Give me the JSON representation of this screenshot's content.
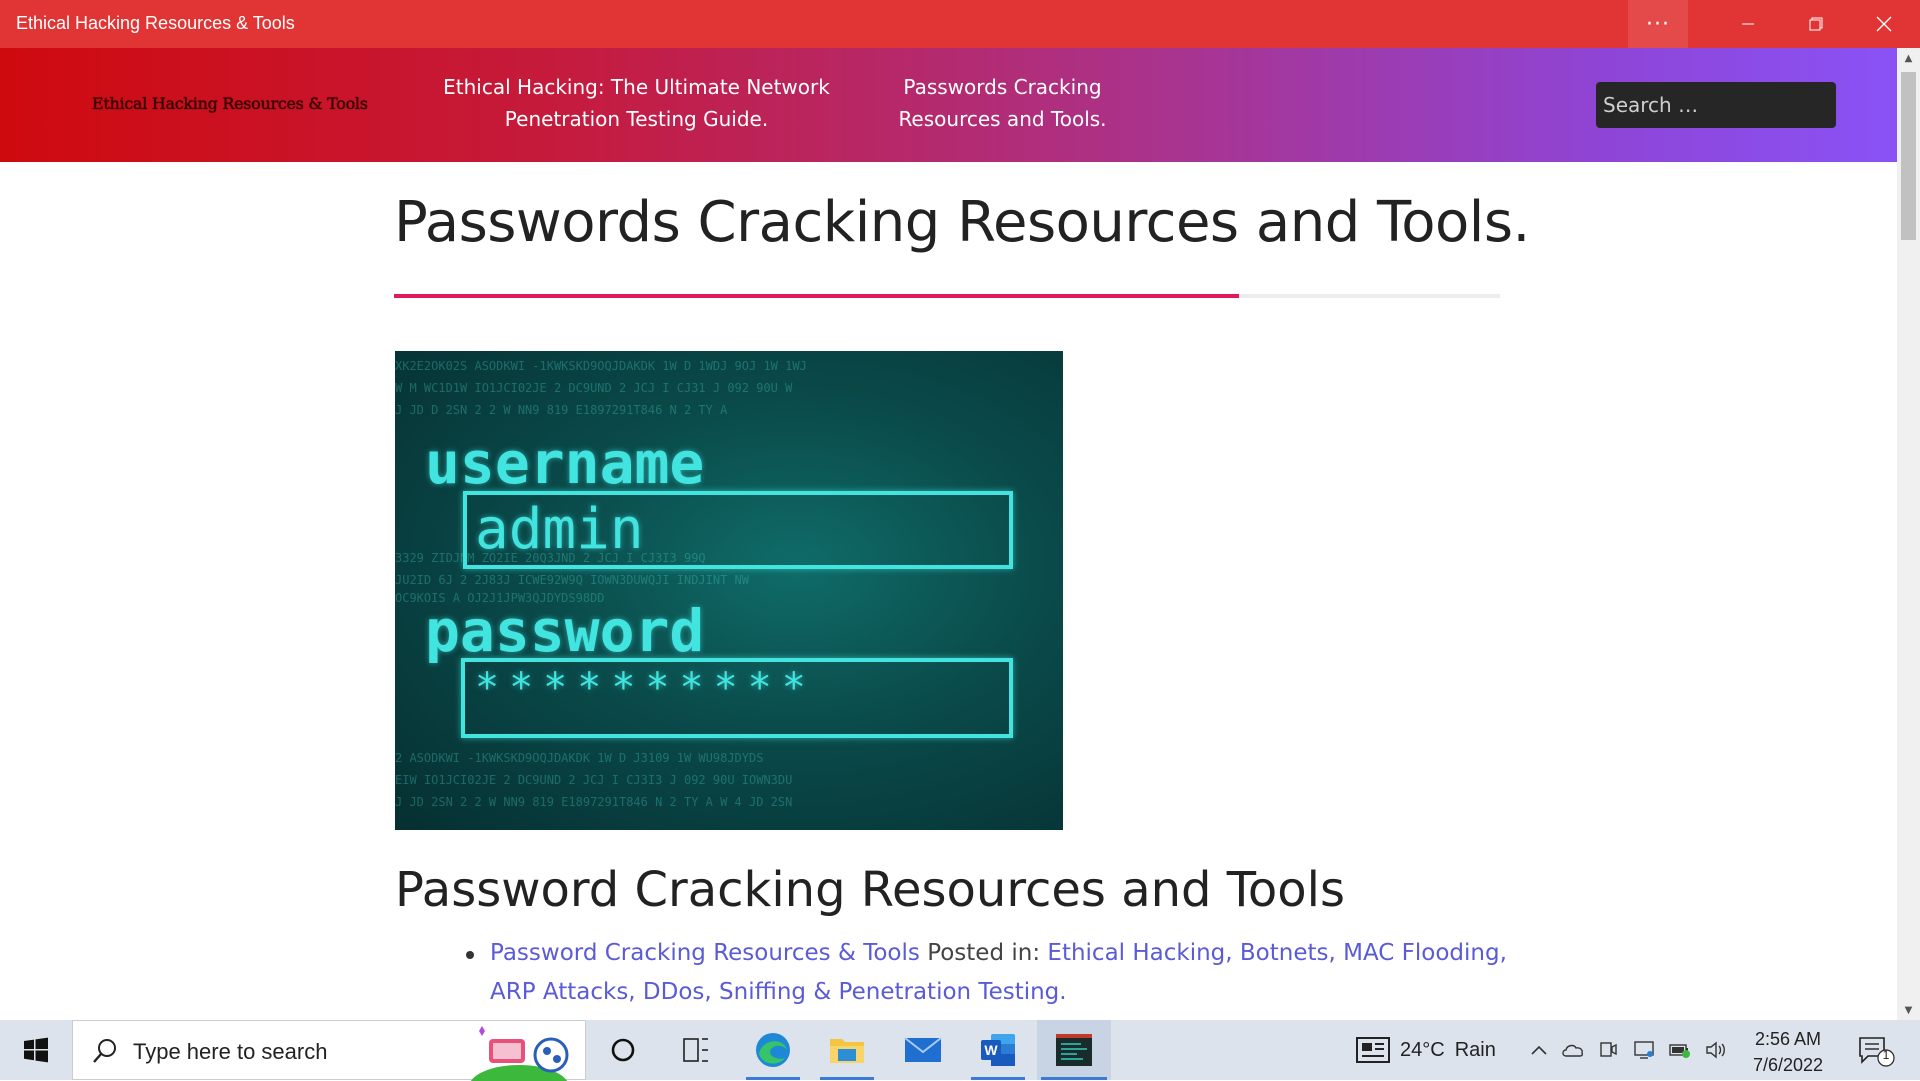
{
  "window": {
    "title": "Ethical Hacking Resources & Tools",
    "more_label": "···"
  },
  "header": {
    "logo_text": "Ethical Hacking Resources & Tools",
    "nav": [
      {
        "label": "Ethical Hacking: The Ultimate Network Penetration Testing Guide."
      },
      {
        "label": "Passwords Cracking Resources and Tools."
      }
    ],
    "search_placeholder": "Search …"
  },
  "main": {
    "page_title": "Passwords Cracking Resources and Tools.",
    "hero_image": {
      "username_label": "username",
      "username_value": "admin",
      "password_label": "password",
      "password_value": "**********"
    },
    "section_heading": "Password Cracking Resources and Tools",
    "list": [
      {
        "link": "Password Cracking Resources & Tools",
        "posted_in": "Posted in:",
        "categories": "Ethical Hacking, Botnets, MAC Flooding, ARP Attacks, DDos, Sniffing & Penetration Testing."
      }
    ]
  },
  "taskbar": {
    "search_placeholder": "Type here to search",
    "weather_temp": "24°C",
    "weather_cond": "Rain",
    "time": "2:56 AM",
    "date": "7/6/2022",
    "notification_count": "1"
  },
  "colors": {
    "titlebar": "#e03534",
    "header_start": "#cf0a0e",
    "header_end": "#8a52f6",
    "title_accent": "#e01a5b",
    "link": "#5b5bd6"
  }
}
